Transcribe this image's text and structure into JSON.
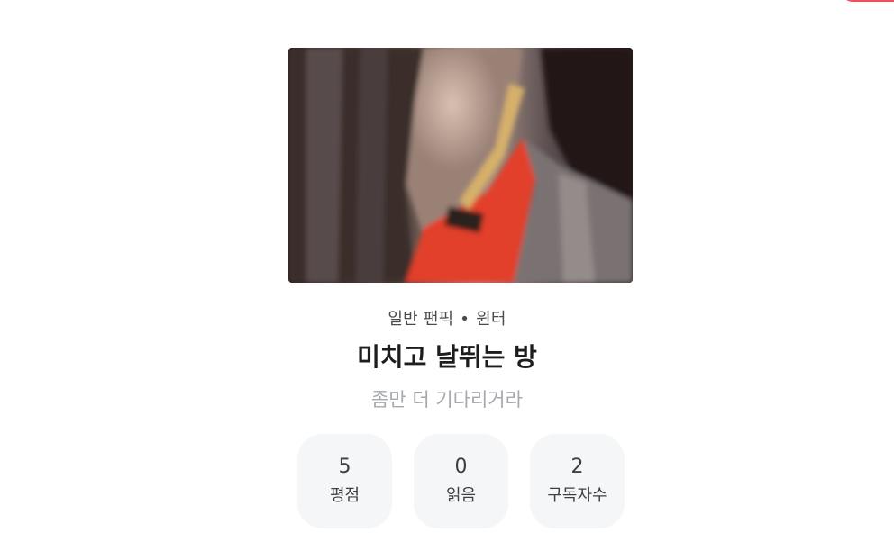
{
  "work": {
    "category": "일반 팬픽",
    "genre": "윈터",
    "separator": "•",
    "title": "미치고 날뛰는 방",
    "subtitle": "좀만 더 기다리거라"
  },
  "stats": [
    {
      "value": "5",
      "label": "평점"
    },
    {
      "value": "0",
      "label": "읽음"
    },
    {
      "value": "2",
      "label": "구독자수"
    }
  ],
  "colors": {
    "accent": "#f0505a",
    "stat_bg": "#f5f6f8",
    "subtitle": "#a5a8ad",
    "title": "#1d1d1f"
  }
}
